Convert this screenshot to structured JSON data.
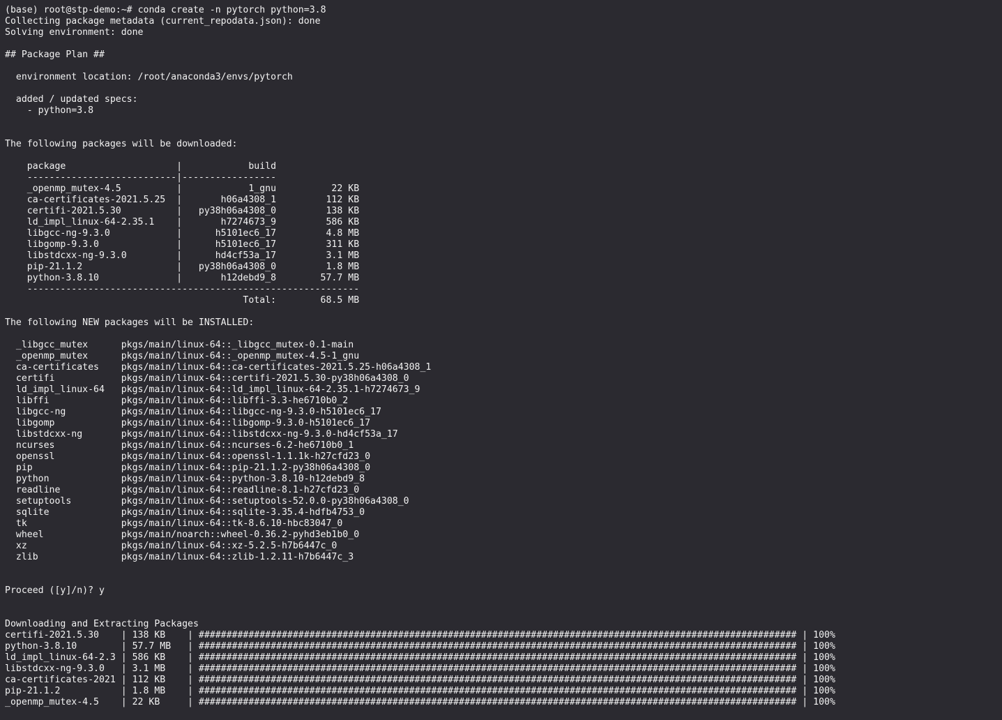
{
  "terminal": {
    "prompt": "(base) root@stp-demo:~# ",
    "command": "conda create -n pytorch python=3.8",
    "lines": [
      "Collecting package metadata (current_repodata.json): done",
      "Solving environment: done",
      "",
      "## Package Plan ##",
      "",
      "  environment location: /root/anaconda3/envs/pytorch",
      "",
      "  added / updated specs:",
      "    - python=3.8",
      "",
      "",
      "The following packages will be downloaded:",
      "",
      "    package                    |            build",
      "    ---------------------------|-----------------",
      "    _openmp_mutex-4.5          |            1_gnu          22 KB",
      "    ca-certificates-2021.5.25  |       h06a4308_1         112 KB",
      "    certifi-2021.5.30          |   py38h06a4308_0         138 KB",
      "    ld_impl_linux-64-2.35.1    |       h7274673_9         586 KB",
      "    libgcc-ng-9.3.0            |      h5101ec6_17         4.8 MB",
      "    libgomp-9.3.0              |      h5101ec6_17         311 KB",
      "    libstdcxx-ng-9.3.0         |      hd4cf53a_17         3.1 MB",
      "    pip-21.1.2                 |   py38h06a4308_0         1.8 MB",
      "    python-3.8.10              |       h12debd9_8        57.7 MB",
      "    ------------------------------------------------------------",
      "                                           Total:        68.5 MB",
      "",
      "The following NEW packages will be INSTALLED:",
      "",
      "  _libgcc_mutex      pkgs/main/linux-64::_libgcc_mutex-0.1-main",
      "  _openmp_mutex      pkgs/main/linux-64::_openmp_mutex-4.5-1_gnu",
      "  ca-certificates    pkgs/main/linux-64::ca-certificates-2021.5.25-h06a4308_1",
      "  certifi            pkgs/main/linux-64::certifi-2021.5.30-py38h06a4308_0",
      "  ld_impl_linux-64   pkgs/main/linux-64::ld_impl_linux-64-2.35.1-h7274673_9",
      "  libffi             pkgs/main/linux-64::libffi-3.3-he6710b0_2",
      "  libgcc-ng          pkgs/main/linux-64::libgcc-ng-9.3.0-h5101ec6_17",
      "  libgomp            pkgs/main/linux-64::libgomp-9.3.0-h5101ec6_17",
      "  libstdcxx-ng       pkgs/main/linux-64::libstdcxx-ng-9.3.0-hd4cf53a_17",
      "  ncurses            pkgs/main/linux-64::ncurses-6.2-he6710b0_1",
      "  openssl            pkgs/main/linux-64::openssl-1.1.1k-h27cfd23_0",
      "  pip                pkgs/main/linux-64::pip-21.1.2-py38h06a4308_0",
      "  python             pkgs/main/linux-64::python-3.8.10-h12debd9_8",
      "  readline           pkgs/main/linux-64::readline-8.1-h27cfd23_0",
      "  setuptools         pkgs/main/linux-64::setuptools-52.0.0-py38h06a4308_0",
      "  sqlite             pkgs/main/linux-64::sqlite-3.35.4-hdfb4753_0",
      "  tk                 pkgs/main/linux-64::tk-8.6.10-hbc83047_0",
      "  wheel              pkgs/main/noarch::wheel-0.36.2-pyhd3eb1b0_0",
      "  xz                 pkgs/main/linux-64::xz-5.2.5-h7b6447c_0",
      "  zlib               pkgs/main/linux-64::zlib-1.2.11-h7b6447c_3",
      "",
      "",
      "Proceed ([y]/n)? y",
      "",
      "",
      "Downloading and Extracting Packages",
      "certifi-2021.5.30    | 138 KB    | ############################################################################################################ | 100% ",
      "python-3.8.10        | 57.7 MB   | ############################################################################################################ | 100% ",
      "ld_impl_linux-64-2.3 | 586 KB    | ############################################################################################################ | 100% ",
      "libstdcxx-ng-9.3.0   | 3.1 MB    | ############################################################################################################ | 100% ",
      "ca-certificates-2021 | 112 KB    | ############################################################################################################ | 100% ",
      "pip-21.1.2           | 1.8 MB    | ############################################################################################################ | 100% ",
      "_openmp_mutex-4.5    | 22 KB     | ############################################################################################################ | 100% "
    ]
  },
  "colors": {
    "background": "#2b2a30",
    "foreground": "#f2f2f2"
  }
}
